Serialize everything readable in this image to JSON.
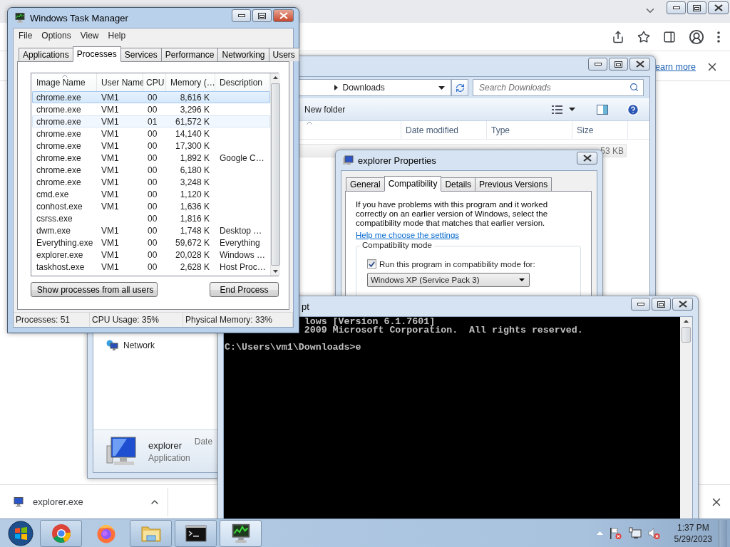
{
  "browser": {
    "info_bar": {
      "link": "earn more"
    },
    "download_bar": {
      "item": "explorer.exe"
    }
  },
  "explorer": {
    "address": "Downloads",
    "search": {
      "placeholder": "Search Downloads"
    },
    "toolbar": {
      "new_folder": "New folder"
    },
    "columns": [
      "Date modified",
      "Type",
      "Size"
    ],
    "file": {
      "size": "53 KB"
    },
    "nav_items": [
      {
        "label": "Network"
      }
    ],
    "details": {
      "name": "explorer",
      "type": "Application",
      "field_label": "Date"
    }
  },
  "properties": {
    "title": "explorer Properties",
    "tabs": [
      {
        "label": "General",
        "selected": false
      },
      {
        "label": "Compatibility",
        "selected": true
      },
      {
        "label": "Details",
        "selected": false
      },
      {
        "label": "Previous Versions",
        "selected": false
      }
    ],
    "description": "If you have problems with this program and it worked correctly on an earlier version of Windows, select the compatibility mode that matches that earlier version.",
    "help_link": "Help me choose the settings",
    "group_title": "Compatibility mode",
    "compat_checkbox": {
      "label": "Run this program in compatibility mode for:",
      "checked": true
    },
    "mode_select": {
      "value": "Windows XP (Service Pack 3)"
    }
  },
  "console": {
    "title": "pt",
    "header": [
      "lows [Version 6.1.7601]",
      "2009 Microsoft Corporation.  All rights reserved."
    ],
    "prompt": "C:\\Users\\vm1\\Downloads>e"
  },
  "task_manager": {
    "title": "Windows Task Manager",
    "menu": [
      "File",
      "Options",
      "View",
      "Help"
    ],
    "tabs": [
      {
        "label": "Applications",
        "selected": false
      },
      {
        "label": "Processes",
        "selected": true
      },
      {
        "label": "Services",
        "selected": false
      },
      {
        "label": "Performance",
        "selected": false
      },
      {
        "label": "Networking",
        "selected": false
      },
      {
        "label": "Users",
        "selected": false
      }
    ],
    "columns": [
      "Image Name",
      "User Name",
      "CPU",
      "Memory (…",
      "Description"
    ],
    "rows": [
      {
        "image": "chrome.exe",
        "user": "VM1",
        "cpu": "00",
        "memory": "8,616 K",
        "selected": true,
        "hovered": false
      },
      {
        "image": "chrome.exe",
        "user": "VM1",
        "cpu": "00",
        "memory": "3,296 K",
        "selected": false,
        "hovered": false
      },
      {
        "image": "chrome.exe",
        "user": "VM1",
        "cpu": "01",
        "memory": "61,572 K",
        "selected": false,
        "hovered": true
      },
      {
        "image": "chrome.exe",
        "user": "VM1",
        "cpu": "00",
        "memory": "14,140 K",
        "selected": false,
        "hovered": false
      },
      {
        "image": "chrome.exe",
        "user": "VM1",
        "cpu": "00",
        "memory": "17,300 K",
        "selected": false,
        "hovered": false
      },
      {
        "image": "chrome.exe",
        "user": "VM1",
        "cpu": "00",
        "memory": "1,892 K",
        "description": "Google C…",
        "selected": false,
        "hovered": false
      },
      {
        "image": "chrome.exe",
        "user": "VM1",
        "cpu": "00",
        "memory": "6,180 K",
        "selected": false,
        "hovered": false
      },
      {
        "image": "chrome.exe",
        "user": "VM1",
        "cpu": "00",
        "memory": "3,248 K",
        "selected": false,
        "hovered": false
      },
      {
        "image": "cmd.exe",
        "user": "VM1",
        "cpu": "00",
        "memory": "1,120 K",
        "selected": false,
        "hovered": false
      },
      {
        "image": "conhost.exe",
        "user": "VM1",
        "cpu": "00",
        "memory": "1,636 K",
        "selected": false,
        "hovered": false
      },
      {
        "image": "csrss.exe",
        "cpu": "00",
        "memory": "1,816 K",
        "selected": false,
        "hovered": false
      },
      {
        "image": "dwm.exe",
        "user": "VM1",
        "cpu": "00",
        "memory": "1,748 K",
        "description": "Desktop …",
        "selected": false,
        "hovered": false
      },
      {
        "image": "Everything.exe",
        "user": "VM1",
        "cpu": "00",
        "memory": "59,672 K",
        "description": "Everything",
        "selected": false,
        "hovered": false
      },
      {
        "image": "explorer.exe",
        "user": "VM1",
        "cpu": "00",
        "memory": "20,028 K",
        "description": "Windows …",
        "selected": false,
        "hovered": false
      },
      {
        "image": "taskhost.exe",
        "user": "VM1",
        "cpu": "00",
        "memory": "2,628 K",
        "description": "Host Proc…",
        "selected": false,
        "hovered": false
      }
    ],
    "buttons": {
      "show_all": "Show processes from all users",
      "end": "End Process"
    },
    "status_bar": [
      "Processes: 51",
      "CPU Usage: 35%",
      "Physical Memory: 33%"
    ]
  },
  "taskbar": {
    "apps": [
      {
        "kind": "chrome",
        "running": true,
        "selected": false
      },
      {
        "kind": "firefox",
        "running": false,
        "selected": false
      },
      {
        "kind": "folder",
        "running": true,
        "selected": false
      },
      {
        "kind": "console",
        "running": true,
        "selected": false
      },
      {
        "kind": "task-manager",
        "running": true,
        "selected": true
      }
    ],
    "clock": {
      "time": "1:37 PM",
      "date": "5/29/2023"
    }
  }
}
